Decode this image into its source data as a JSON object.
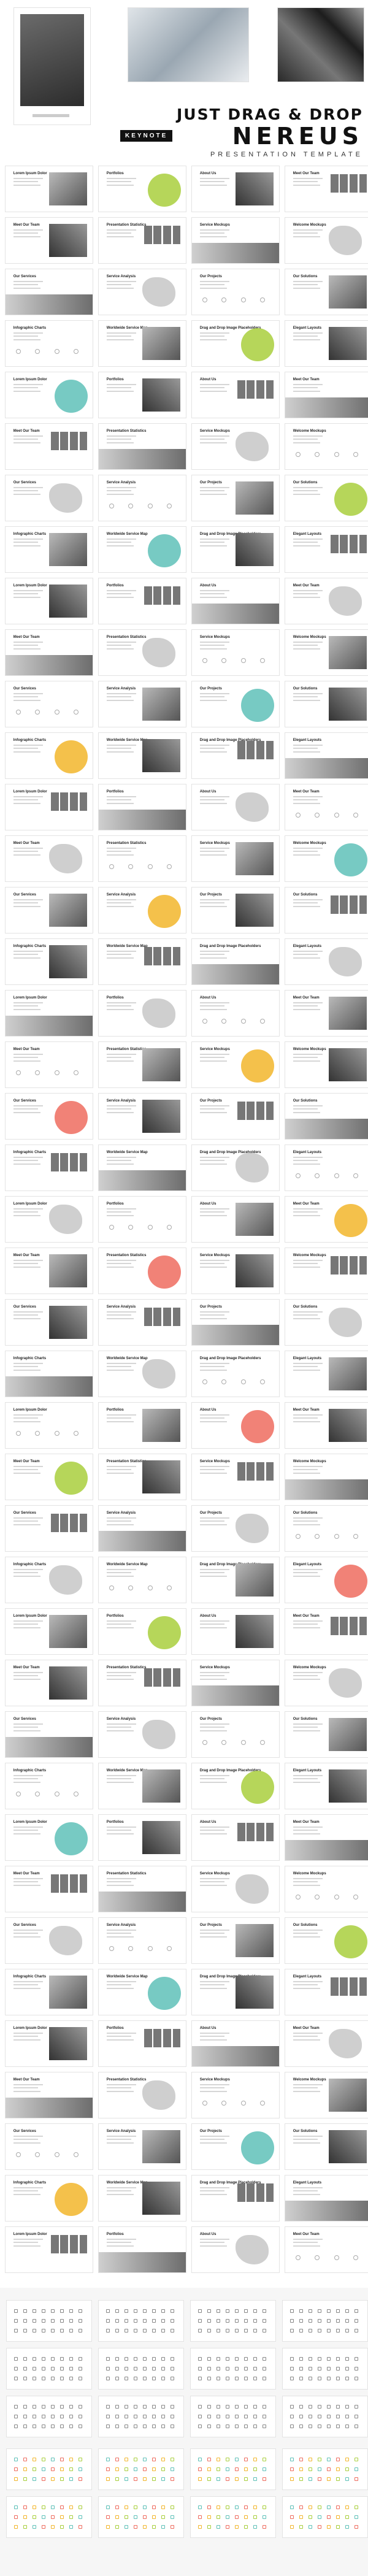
{
  "header": {
    "line1": "JUST DRAG & DROP",
    "badge": "KEYNOTE",
    "line2": "NEREUS",
    "line3": "PRESENTATION TEMPLATE"
  },
  "colors": {
    "teal": "#5fc1b8",
    "green": "#a9cf3d",
    "coral": "#ee6c5f",
    "gold": "#f2b62c"
  },
  "slide_titles": [
    "Lorem Ipsum Dolor",
    "Portfolios",
    "About Us",
    "Meet Our Team",
    "Meet Our Team",
    "Presentation Statistics",
    "Service Mockups",
    "Welcome Mockups",
    "Our Services",
    "Service Analysis",
    "Our Projects",
    "Our Solutions",
    "Infographic Charts",
    "Worldwide Service Map",
    "Drag and Drop Image Placeholders",
    "Elegant Layouts"
  ]
}
